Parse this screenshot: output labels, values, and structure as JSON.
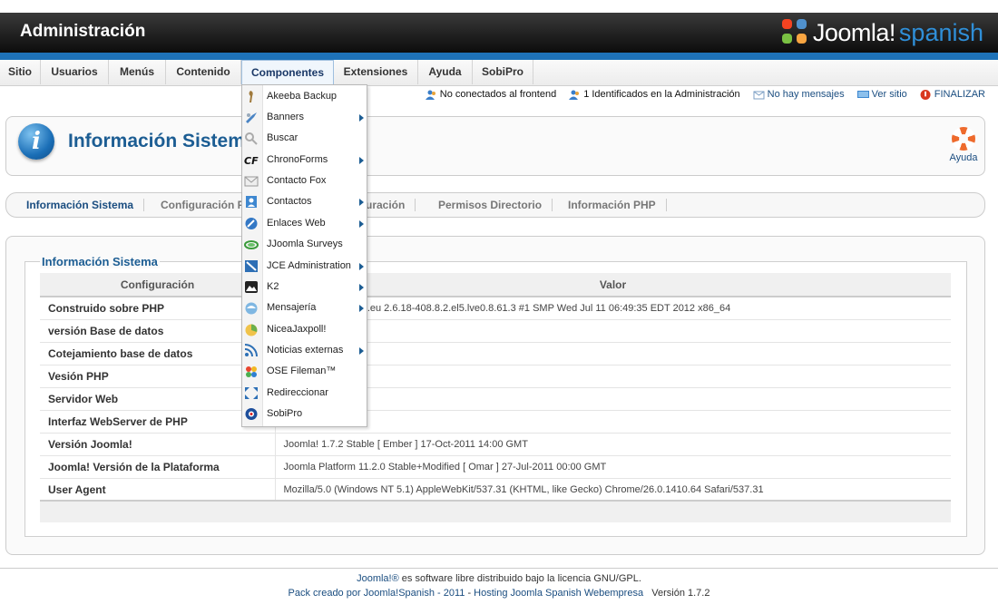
{
  "header": {
    "title": "Administración",
    "logo_word": "Joomla!",
    "logo_spanish": "spanish"
  },
  "menu": [
    {
      "label": "Sitio"
    },
    {
      "label": "Usuarios"
    },
    {
      "label": "Menús"
    },
    {
      "label": "Contenido"
    },
    {
      "label": "Componentes",
      "active": true
    },
    {
      "label": "Extensiones"
    },
    {
      "label": "Ayuda"
    },
    {
      "label": "SobiPro"
    }
  ],
  "status": {
    "frontend": "No conectados al frontend",
    "admin": "1 Identificados en la Administración",
    "messages": "No hay mensajes",
    "view_site": "Ver sitio",
    "logout": "FINALIZAR"
  },
  "toolbar": {
    "title": "Información Sistema",
    "help_label": "Ayuda"
  },
  "subtabs": [
    {
      "label": "Información Sistema",
      "active": true
    },
    {
      "label": "Configuración PHP"
    },
    {
      "label": "Configuración"
    },
    {
      "label": "Permisos Directorio"
    },
    {
      "label": "Información PHP"
    }
  ],
  "panel": {
    "legend": "Información Sistema",
    "col_config": "Configuración",
    "col_value": "Valor",
    "rows": [
      {
        "key": "Construido sobre PHP",
        "value": "Linux webempresa.eu 2.6.18-408.8.2.el5.lve0.8.61.3 #1 SMP Wed Jul 11 06:49:35 EDT 2012 x86_64"
      },
      {
        "key": "versión Base de datos",
        "value": ""
      },
      {
        "key": "Cotejamiento base de datos",
        "value": ""
      },
      {
        "key": "Vesión PHP",
        "value": ""
      },
      {
        "key": "Servidor Web",
        "value": ""
      },
      {
        "key": "Interfaz WebServer de PHP",
        "value": ""
      },
      {
        "key": "Versión Joomla!",
        "value": "Joomla! 1.7.2 Stable [ Ember ] 17-Oct-2011 14:00 GMT"
      },
      {
        "key": "Joomla! Versión de la Plataforma",
        "value": "Joomla Platform 11.2.0 Stable+Modified [ Omar ] 27-Jul-2011 00:00 GMT"
      },
      {
        "key": "User Agent",
        "value": "Mozilla/5.0 (Windows NT 5.1) AppleWebKit/537.31 (KHTML, like Gecko) Chrome/26.0.1410.64 Safari/537.31"
      }
    ]
  },
  "dropdown": [
    {
      "label": "Akeeba Backup",
      "icon": "akeeba-icon",
      "submenu": false
    },
    {
      "label": "Banners",
      "icon": "banners-icon",
      "submenu": true
    },
    {
      "label": "Buscar",
      "icon": "search-icon",
      "submenu": false
    },
    {
      "label": "ChronoForms",
      "icon": "chronoforms-icon",
      "submenu": true
    },
    {
      "label": "Contacto Fox",
      "icon": "envelope-icon",
      "submenu": false
    },
    {
      "label": "Contactos",
      "icon": "contacts-icon",
      "submenu": true
    },
    {
      "label": "Enlaces Web",
      "icon": "weblinks-icon",
      "submenu": true
    },
    {
      "label": "JJoomla Surveys",
      "icon": "surveys-icon",
      "submenu": false
    },
    {
      "label": "JCE Administration",
      "icon": "jce-icon",
      "submenu": true
    },
    {
      "label": "K2",
      "icon": "k2-icon",
      "submenu": true
    },
    {
      "label": "Mensajería",
      "icon": "messaging-icon",
      "submenu": true
    },
    {
      "label": "NiceaJaxpoll!",
      "icon": "poll-icon",
      "submenu": false
    },
    {
      "label": "Noticias externas",
      "icon": "rss-icon",
      "submenu": true
    },
    {
      "label": "OSE Fileman™",
      "icon": "fileman-icon",
      "submenu": false
    },
    {
      "label": "Redireccionar",
      "icon": "redirect-icon",
      "submenu": false
    },
    {
      "label": "SobiPro",
      "icon": "sobipro-icon",
      "submenu": false
    }
  ],
  "footer": {
    "line1_link": "Joomla!®",
    "line1_text": " es software libre distribuido bajo la licencia GNU/GPL.",
    "line2_link1": "Pack creado por Joomla!Spanish - 2011",
    "line2_sep": " - ",
    "line2_link2": "Hosting Joomla Spanish Webempresa",
    "line2_version": "Versión 1.7.2"
  }
}
